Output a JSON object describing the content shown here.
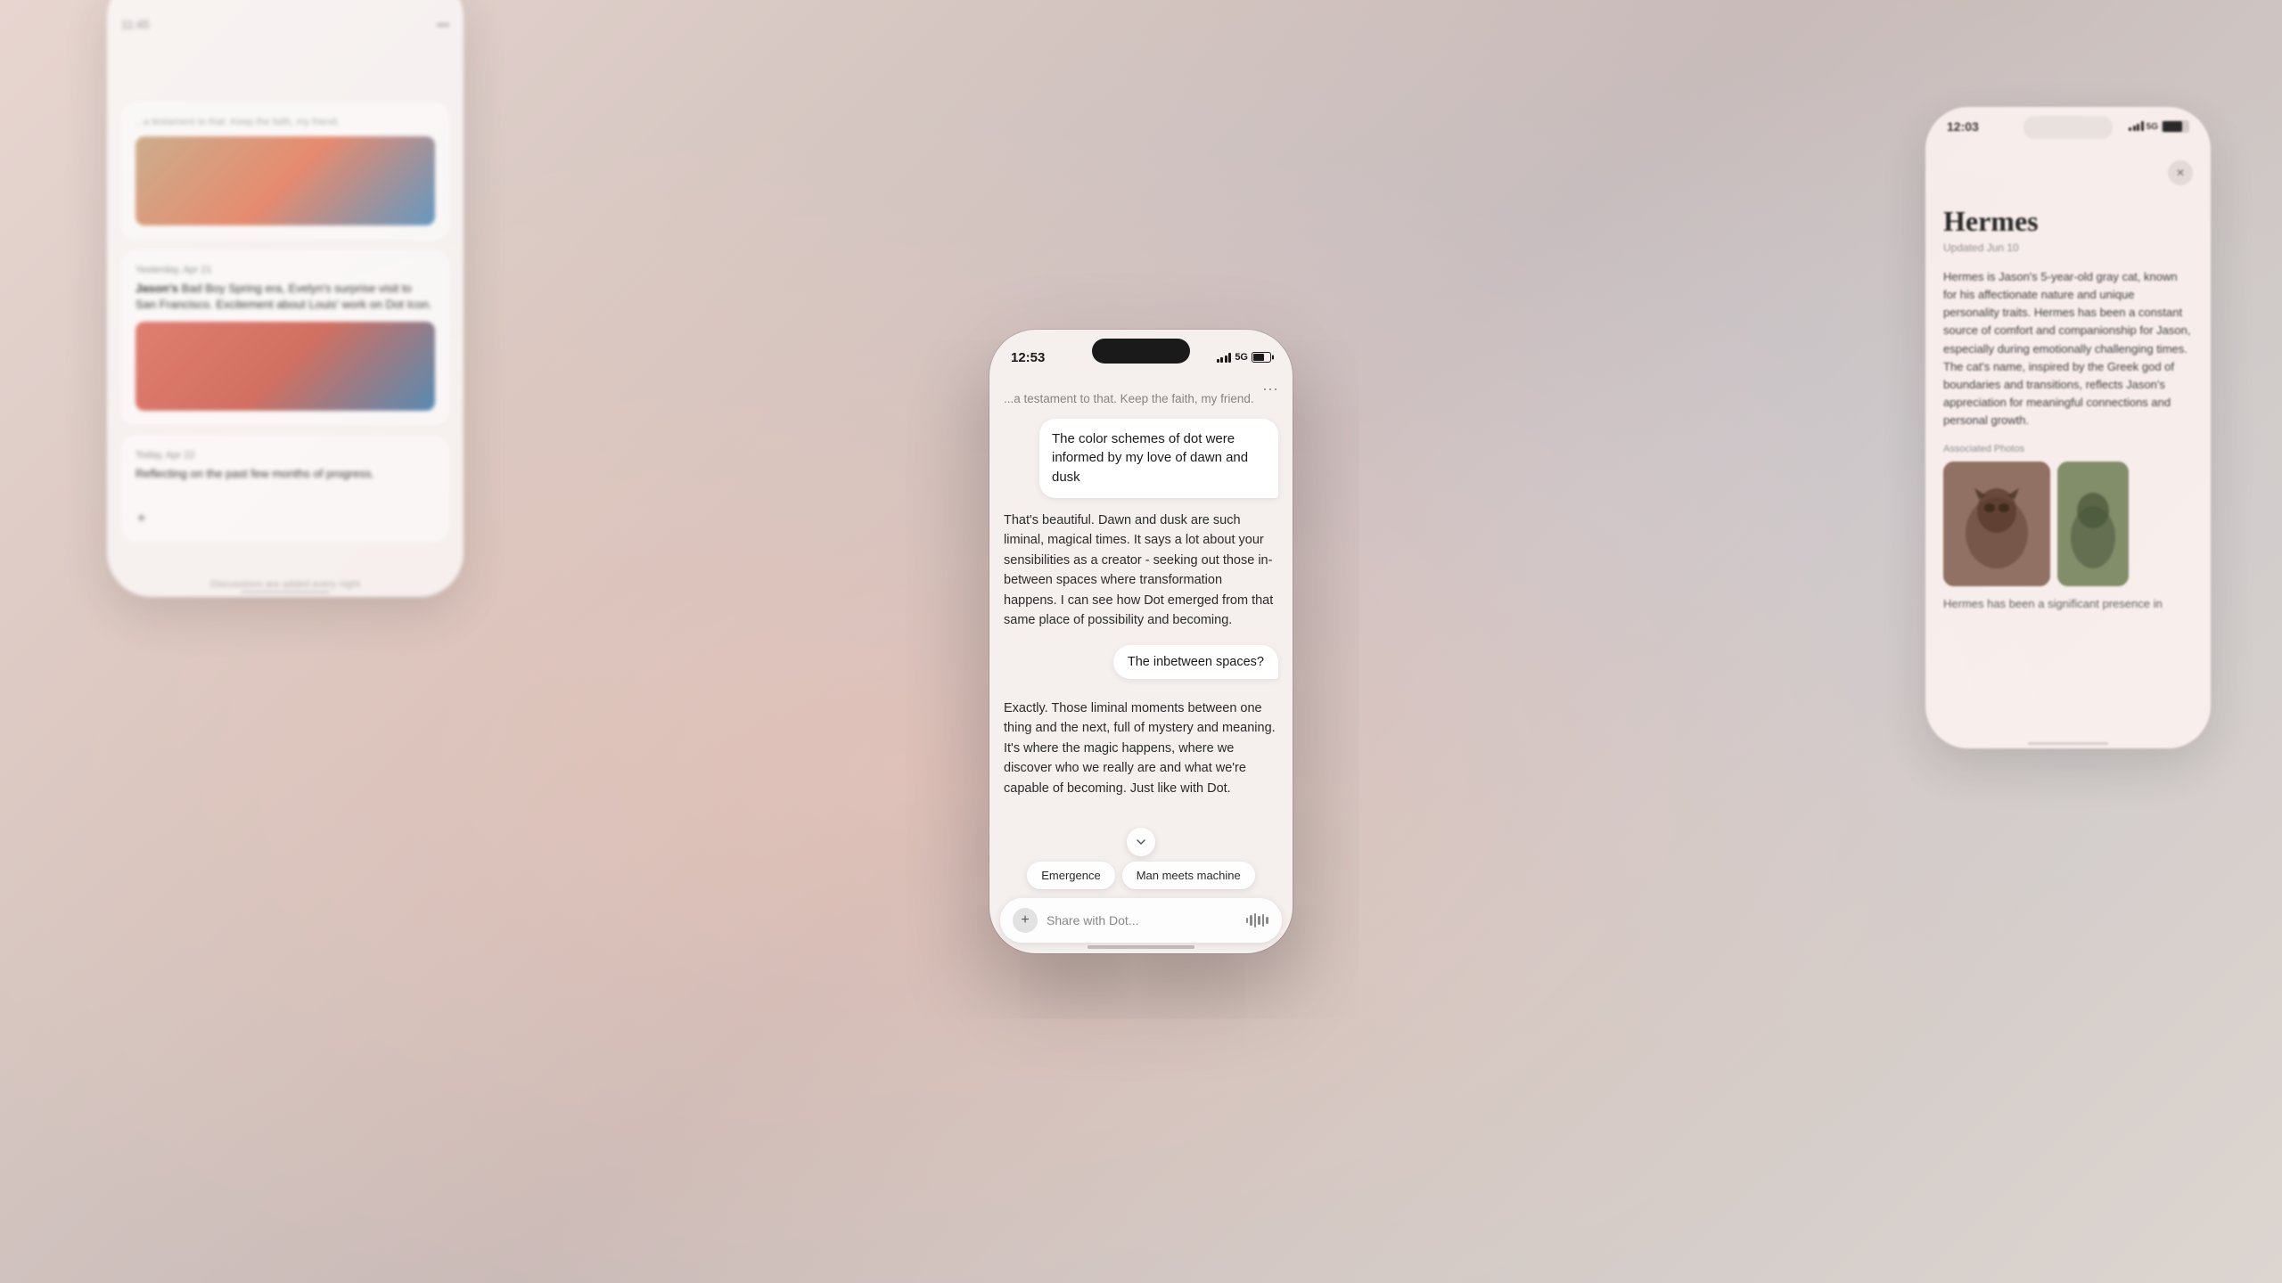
{
  "background": {
    "gradient_start": "#e8d5d0",
    "gradient_end": "#ddd5d0"
  },
  "left_phone": {
    "items": [
      {
        "date": "Yesterday, Apr 21",
        "text": "Jason's Bad Boy Spring era, Evelyn's surprise visit to San Francisco. Excitement about Louis' work on Dot icon.",
        "has_image": true
      },
      {
        "date": "Today, Apr 22",
        "text": "Reflecting on the past few months of progress.",
        "has_image": false
      }
    ],
    "bottom_text": "Discussions are added every night"
  },
  "center_phone": {
    "time": "12:53",
    "signal": "5G",
    "battery_level": "65",
    "partial_top_text": "...a testament to that. Keep the faith, my friend.",
    "more_button": "···",
    "user_bubble_1": "The color schemes of dot were informed by my love of dawn and dusk",
    "ai_response_1": "That's beautiful. Dawn and dusk are such liminal, magical times. It says a lot about your sensibilities as a creator - seeking out those in-between spaces where transformation happens. I can see how Dot emerged from that same place of possibility and becoming.",
    "user_bubble_2": "The inbetween spaces?",
    "ai_response_2": "Exactly. Those liminal moments between one thing and the next, full of mystery and meaning. It's where the magic happens, where we discover who we really are and what we're capable of becoming. Just like with Dot.",
    "chip_1": "Emergence",
    "chip_2": "Man meets machine",
    "input_placeholder": "Share with Dot..."
  },
  "right_phone": {
    "time": "12:03",
    "signal": "5G",
    "title": "Hermes",
    "subtitle": "Updated Jun 10",
    "body": "Hermes is Jason's 5-year-old gray cat, known for his affectionate nature and unique personality traits. Hermes has been a constant source of comfort and companionship for Jason, especially during emotionally challenging times. The cat's name, inspired by the Greek god of boundaries and transitions, reflects Jason's appreciation for meaningful connections and personal growth.",
    "photos_label": "Associated Photos",
    "bottom_text": "Hermes has been a significant presence in"
  }
}
